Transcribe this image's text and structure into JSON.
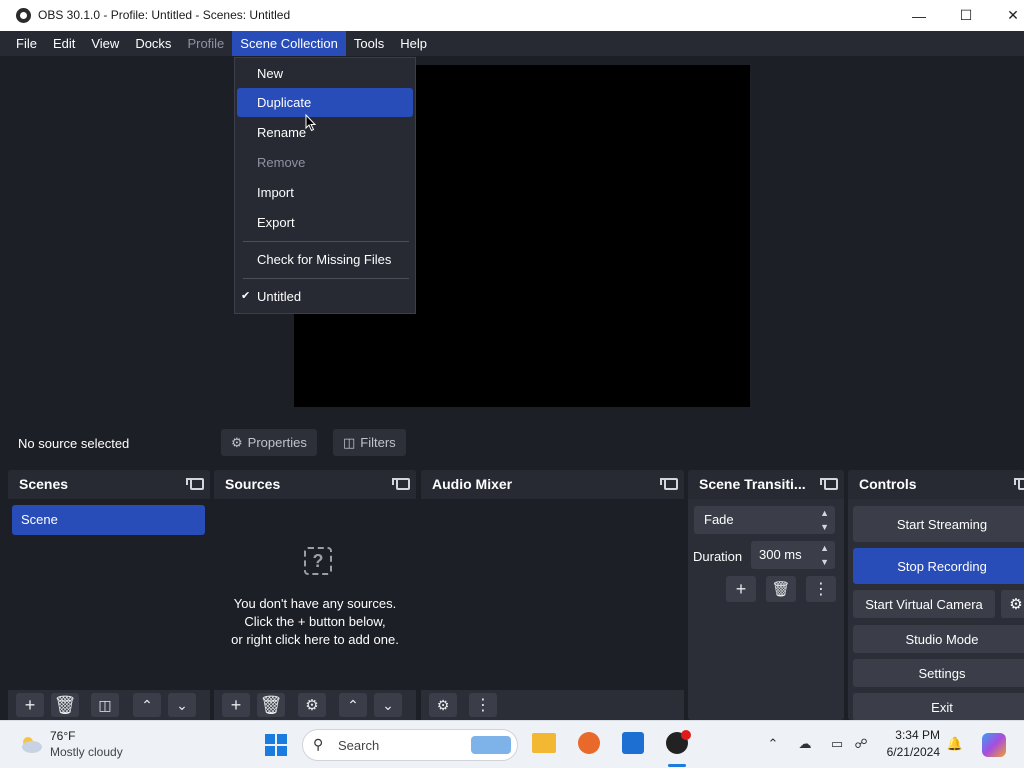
{
  "window": {
    "title": "OBS 30.1.0 - Profile: Untitled - Scenes: Untitled"
  },
  "menubar": [
    {
      "label": "File",
      "state": "normal"
    },
    {
      "label": "Edit",
      "state": "normal"
    },
    {
      "label": "View",
      "state": "normal"
    },
    {
      "label": "Docks",
      "state": "normal"
    },
    {
      "label": "Profile",
      "state": "disabled"
    },
    {
      "label": "Scene Collection",
      "state": "active"
    },
    {
      "label": "Tools",
      "state": "normal"
    },
    {
      "label": "Help",
      "state": "normal"
    }
  ],
  "dropdown": {
    "items": [
      {
        "label": "New"
      },
      {
        "label": "Duplicate"
      },
      {
        "label": "Rename"
      },
      {
        "label": "Remove"
      },
      {
        "label": "Import"
      },
      {
        "label": "Export"
      },
      {
        "label": "Check for Missing Files"
      },
      {
        "label": "Untitled"
      }
    ]
  },
  "source_bar": {
    "no_source": "No source selected",
    "properties": "Properties",
    "filters": "Filters"
  },
  "docks": {
    "scenes": {
      "title": "Scenes",
      "items": [
        "Scene"
      ]
    },
    "sources": {
      "title": "Sources",
      "empty_line1": "You don't have any sources.",
      "empty_line2": "Click the + button below,",
      "empty_line3": "or right click here to add one."
    },
    "audio": {
      "title": "Audio Mixer"
    },
    "transitions": {
      "title": "Scene Transiti...",
      "selected": "Fade",
      "duration_label": "Duration",
      "duration_value": "300 ms"
    },
    "controls": {
      "title": "Controls",
      "start_streaming": "Start Streaming",
      "stop_recording": "Stop Recording",
      "start_virtual_camera": "Start Virtual Camera",
      "studio_mode": "Studio Mode",
      "settings": "Settings",
      "exit": "Exit"
    }
  },
  "taskbar": {
    "weather_temp": "76°F",
    "weather_desc": "Mostly cloudy",
    "search_placeholder": "Search",
    "time": "3:34 PM",
    "date": "6/21/2024"
  },
  "colors": {
    "accent": "#284cb8",
    "panel": "#2b2e37",
    "background": "#1d1f26"
  }
}
